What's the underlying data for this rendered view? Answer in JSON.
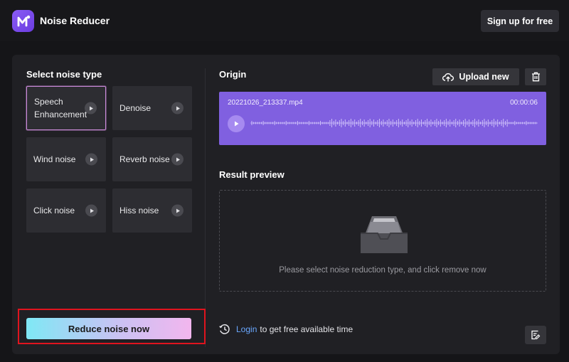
{
  "app": {
    "title": "Noise Reducer",
    "signup_label": "Sign up for free"
  },
  "left": {
    "title": "Select noise type",
    "noise_types": [
      {
        "label": "Speech Enhancement",
        "selected": true
      },
      {
        "label": "Denoise",
        "selected": false
      },
      {
        "label": "Wind noise",
        "selected": false
      },
      {
        "label": "Reverb noise",
        "selected": false
      },
      {
        "label": "Click noise",
        "selected": false
      },
      {
        "label": "Hiss noise",
        "selected": false
      }
    ],
    "reduce_button": "Reduce noise now"
  },
  "origin": {
    "title": "Origin",
    "upload_label": "Upload new",
    "file_name": "20221026_213337.mp4",
    "duration": "00:00:06"
  },
  "result": {
    "title": "Result preview",
    "placeholder": "Please select noise reduction type, and click remove now"
  },
  "footer": {
    "login_link": "Login",
    "login_text": "to get free available time"
  },
  "colors": {
    "accent": "#8060e0",
    "highlight": "#e0141e",
    "link": "#6aa8ff"
  },
  "icons": [
    "app-logo-icon",
    "play-icon",
    "upload-cloud-icon",
    "trash-icon",
    "empty-tray-icon",
    "clock-icon",
    "feedback-icon"
  ]
}
